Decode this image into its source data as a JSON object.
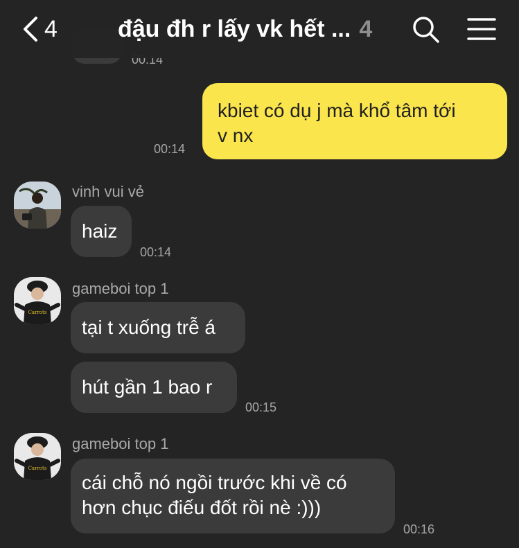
{
  "header": {
    "back_count": "4",
    "title": "đậu đh r lấy vk hết ...",
    "member_count": "4"
  },
  "top_partial": {
    "time": "00:14"
  },
  "messages": [
    {
      "sender": "",
      "text_lines": [
        "kbiet có dụ j mà khổ tâm tới",
        "v nx"
      ],
      "time": "00:14",
      "own": true
    },
    {
      "sender": "vinh vui vẻ",
      "text_lines": [
        "haiz"
      ],
      "time": "00:14"
    },
    {
      "sender": "gameboi top 1",
      "text_lines": [
        "tại t xuống trễ á"
      ],
      "time": ""
    },
    {
      "sender": "",
      "text_lines": [
        "hút gần 1 bao r"
      ],
      "time": "00:15"
    },
    {
      "sender": "gameboi top 1",
      "text_lines": [
        "cái chỗ nó ngồi trước khi về có",
        "hơn chục điếu đốt rồi nè :)))"
      ],
      "time": "00:16"
    }
  ],
  "avatar_badge": {
    "shirt_text": "Carrots"
  },
  "colors": {
    "background": "#242424",
    "own_bubble": "#fbe54c",
    "other_bubble": "#3b3b3b"
  },
  "icons": {
    "back": "chevron-left-icon",
    "search": "search-icon",
    "menu": "menu-icon"
  }
}
